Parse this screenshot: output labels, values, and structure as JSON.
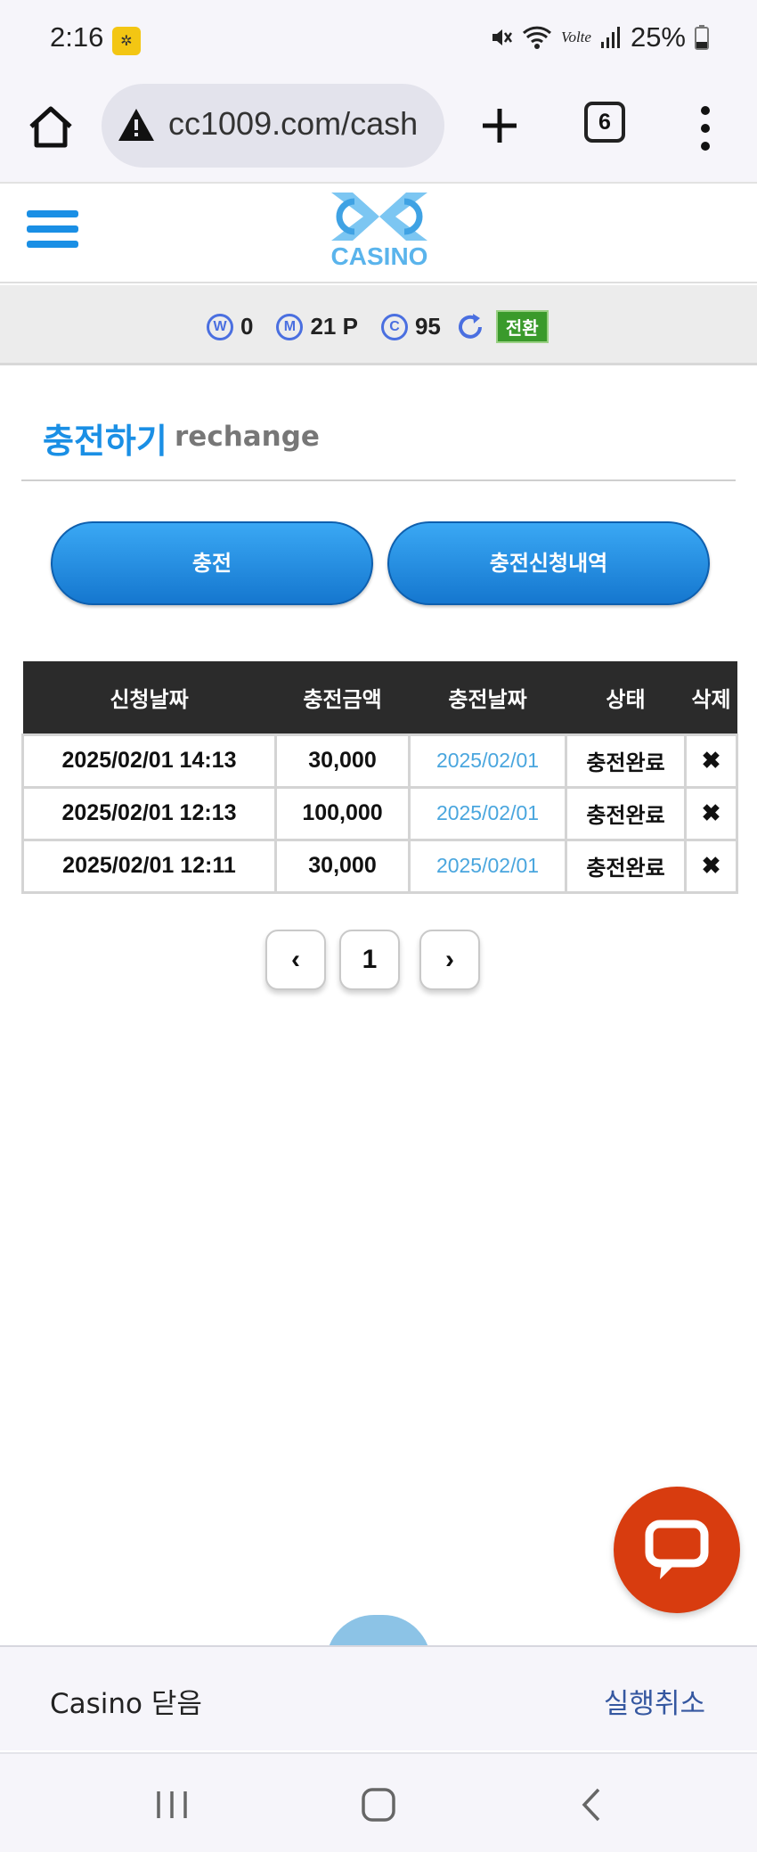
{
  "status_bar": {
    "time": "2:16",
    "battery": "25%",
    "network": "Volte"
  },
  "browser": {
    "url": "cc1009.com/cash",
    "tab_count": "6"
  },
  "site": {
    "logo_text": "CASINO"
  },
  "balance": {
    "w_label": "W",
    "w_value": "0",
    "m_label": "M",
    "m_value": "21 P",
    "c_label": "C",
    "c_value": "95",
    "convert_label": "전환"
  },
  "page": {
    "title": "충전하기",
    "subtitle": "rechange"
  },
  "actions": {
    "recharge_label": "충전",
    "history_label": "충전신청내역"
  },
  "table": {
    "headers": [
      "신청날짜",
      "충전금액",
      "충전날짜",
      "상태",
      "삭제"
    ],
    "rows": [
      {
        "request_date": "2025/02/01 14:13",
        "amount": "30,000",
        "charge_date": "2025/02/01",
        "status": "충전완료",
        "delete": "✖"
      },
      {
        "request_date": "2025/02/01 12:13",
        "amount": "100,000",
        "charge_date": "2025/02/01",
        "status": "충전완료",
        "delete": "✖"
      },
      {
        "request_date": "2025/02/01 12:11",
        "amount": "30,000",
        "charge_date": "2025/02/01",
        "status": "충전완료",
        "delete": "✖"
      }
    ]
  },
  "pagination": {
    "prev": "‹",
    "current": "1",
    "next": "›"
  },
  "snackbar": {
    "text": "Casino 닫음",
    "undo_label": "실행취소"
  },
  "colors": {
    "accent": "#1a8fe5",
    "header_dark": "#2b2b2b",
    "convert_green": "#3a9a2b",
    "chat_fab": "#d83c0f"
  }
}
